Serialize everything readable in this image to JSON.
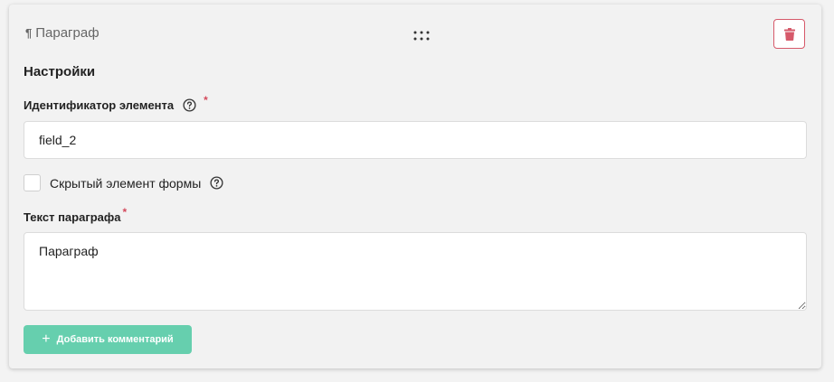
{
  "card": {
    "type_label": "Параграф",
    "pilcrow": "¶",
    "settings_title": "Настройки"
  },
  "element_id": {
    "label": "Идентификатор элемента",
    "required_mark": "*",
    "value": "field_2"
  },
  "hidden_field": {
    "label": "Скрытый элемент формы",
    "checked": false
  },
  "paragraph_text": {
    "label": "Текст параграфа",
    "required_mark": "*",
    "value": "Параграф"
  },
  "add_comment": {
    "plus": "+",
    "label": "Добавить комментарий"
  },
  "colors": {
    "delete_accent": "#d6596a",
    "required": "#d44a5c",
    "button_green": "#66cfae"
  },
  "icons": {
    "type": "pilcrow-icon",
    "drag": "drag-handle-icon",
    "delete": "trash-icon",
    "help": "question-circle-icon",
    "add": "plus-icon"
  }
}
